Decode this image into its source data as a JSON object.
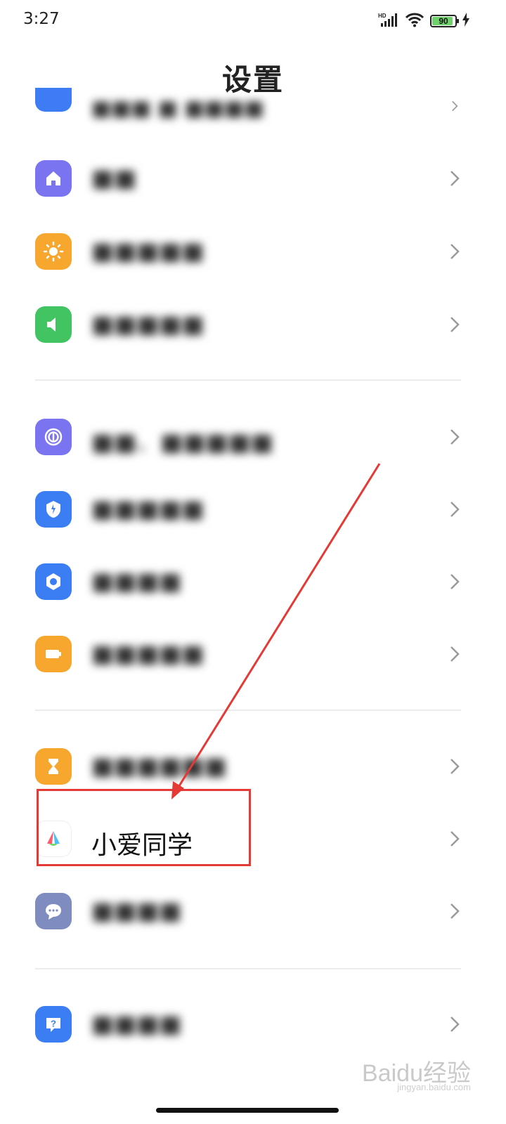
{
  "status_bar": {
    "time": "3:27",
    "network_label": "HD",
    "battery_level": "90",
    "battery_fraction": 0.9,
    "icons": [
      "hd-signal-icon",
      "wifi-icon",
      "battery-icon",
      "charging-bolt-icon"
    ]
  },
  "header": {
    "title": "设置"
  },
  "settings_groups": [
    {
      "items": [
        {
          "label": "■■■ ■ ■■■■",
          "icon": "partial-top-icon",
          "color": "#3d7cf4",
          "blurred": true
        },
        {
          "label": "■■",
          "icon": "home-icon",
          "color": "#7b74f0",
          "blurred": true
        },
        {
          "label": "■■■■■",
          "icon": "sun-icon",
          "color": "#f7a62e",
          "blurred": true
        },
        {
          "label": "■■■■■",
          "icon": "speaker-icon",
          "color": "#43c463",
          "blurred": true
        }
      ]
    },
    {
      "items": [
        {
          "label": "■■、■■■■■",
          "icon": "fingerprint-icon",
          "color": "#7b74f0",
          "blurred": true
        },
        {
          "label": "■■■■■",
          "icon": "shield-icon",
          "color": "#3b7df2",
          "blurred": true
        },
        {
          "label": "■■■■",
          "icon": "hexagon-settings-icon",
          "color": "#3b7df2",
          "blurred": true
        },
        {
          "label": "■■■■■",
          "icon": "battery-box-icon",
          "color": "#f7a62e",
          "blurred": true
        }
      ]
    },
    {
      "items": [
        {
          "label": "■■■■■■",
          "icon": "hourglass-icon",
          "color": "#f7a62e",
          "blurred": true
        },
        {
          "label": "小爱同学",
          "icon": "xiaoai-logo-icon",
          "color": "#ffffff",
          "blurred": false
        },
        {
          "label": "■■■■",
          "icon": "chat-bubble-icon",
          "color": "#7f8cc0",
          "blurred": true
        }
      ]
    },
    {
      "items": [
        {
          "label": "■■■■",
          "icon": "question-icon",
          "color": "#3b7df2",
          "blurred": true
        }
      ]
    }
  ],
  "annotation": {
    "color": "#e53935"
  },
  "watermark": {
    "text": "Baidu经验",
    "sub": "jingyan.baidu.com"
  }
}
